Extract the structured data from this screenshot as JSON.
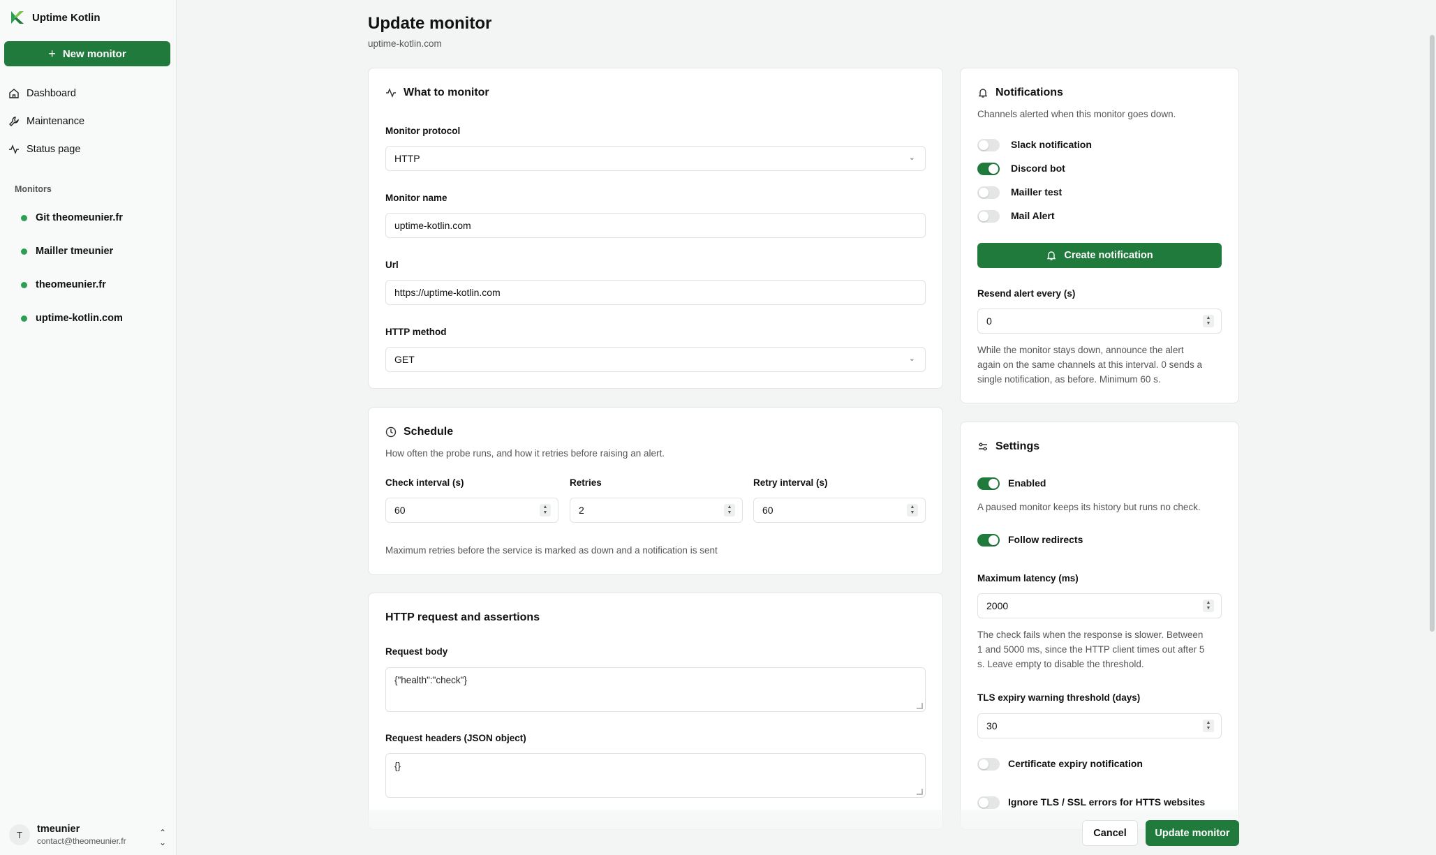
{
  "app": {
    "name": "Uptime Kotlin"
  },
  "sidebar": {
    "new_monitor_label": "New monitor",
    "nav": [
      {
        "label": "Dashboard",
        "icon": "home-icon"
      },
      {
        "label": "Maintenance",
        "icon": "wrench-icon"
      },
      {
        "label": "Status page",
        "icon": "activity-icon"
      }
    ],
    "monitors_section": "Monitors",
    "monitors": [
      {
        "label": "Git theomeunier.fr",
        "status": "up"
      },
      {
        "label": "Mailler tmeunier",
        "status": "up"
      },
      {
        "label": "theomeunier.fr",
        "status": "up"
      },
      {
        "label": "uptime-kotlin.com",
        "status": "up"
      }
    ],
    "user": {
      "initial": "T",
      "name": "tmeunier",
      "email": "contact@theomeunier.fr"
    }
  },
  "page": {
    "title": "Update monitor",
    "subtitle": "uptime-kotlin.com"
  },
  "what": {
    "title": "What to monitor",
    "protocol_label": "Monitor protocol",
    "protocol_value": "HTTP",
    "name_label": "Monitor name",
    "name_value": "uptime-kotlin.com",
    "url_label": "Url",
    "url_value": "https://uptime-kotlin.com",
    "method_label": "HTTP method",
    "method_value": "GET"
  },
  "schedule": {
    "title": "Schedule",
    "desc": "How often the probe runs, and how it retries before raising an alert.",
    "check_label": "Check interval (s)",
    "check_value": "60",
    "retries_label": "Retries",
    "retries_value": "2",
    "retry_label": "Retry interval (s)",
    "retry_value": "60",
    "help": "Maximum retries before the service is marked as down and a notification is sent"
  },
  "http": {
    "title": "HTTP request and assertions",
    "body_label": "Request body",
    "body_value": "{\"health\":\"check\"}",
    "headers_label": "Request headers (JSON object)",
    "headers_value": "{}"
  },
  "notifications": {
    "title": "Notifications",
    "desc": "Channels alerted when this monitor goes down.",
    "channels": [
      {
        "label": "Slack notification",
        "enabled": false
      },
      {
        "label": "Discord bot",
        "enabled": true
      },
      {
        "label": "Mailler test",
        "enabled": false
      },
      {
        "label": "Mail Alert",
        "enabled": false
      }
    ],
    "create_label": "Create notification",
    "resend_label": "Resend alert every (s)",
    "resend_value": "0",
    "resend_help_1": "While the monitor stays down, announce the alert",
    "resend_help_2": "again on the same channels at this interval. 0 sends a",
    "resend_help_3": "single notification, as before. Minimum 60 s."
  },
  "settings": {
    "title": "Settings",
    "enabled_label": "Enabled",
    "enabled": true,
    "enabled_help": "A paused monitor keeps its history but runs no check.",
    "redirects_label": "Follow redirects",
    "redirects": true,
    "latency_label": "Maximum latency (ms)",
    "latency_value": "2000",
    "latency_help_1": "The check fails when the response is slower. Between",
    "latency_help_2": "1 and 5000 ms, since the HTTP client times out after 5",
    "latency_help_3": "s. Leave empty to disable the threshold.",
    "tls_label": "TLS expiry warning threshold (days)",
    "tls_value": "30",
    "cert_label": "Certificate expiry notification",
    "cert": false,
    "ignore_tls_label": "Ignore TLS / SSL errors for HTTS websites",
    "ignore_tls": false
  },
  "footer": {
    "cancel_label": "Cancel",
    "update_label": "Update monitor"
  },
  "colors": {
    "accent": "#1f7a3c",
    "status_up": "#2f9e55"
  }
}
